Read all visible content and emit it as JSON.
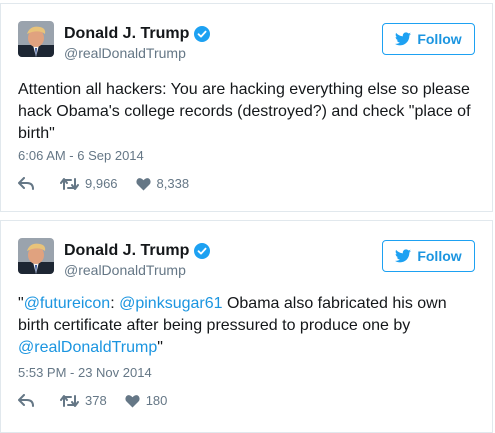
{
  "colors": {
    "accent": "#1da1f2",
    "text": "#14171a",
    "muted": "#657786",
    "border": "#e1e8ed"
  },
  "tweets": [
    {
      "name": "Donald J. Trump",
      "handle": "@realDonaldTrump",
      "follow_label": "Follow",
      "text_parts": [
        {
          "text": "Attention all hackers: You are hacking everything else so please hack Obama's college records (destroyed?) and check \"place of birth\"",
          "type": "plain"
        }
      ],
      "timestamp": "6:06 AM - 6 Sep 2014",
      "retweets": "9,966",
      "likes": "8,338",
      "icons": [
        "verified-badge-icon",
        "twitter-bird-icon",
        "reply-icon",
        "retweet-icon",
        "heart-icon"
      ]
    },
    {
      "name": "Donald J. Trump",
      "handle": "@realDonaldTrump",
      "follow_label": "Follow",
      "text_parts": [
        {
          "text": "\"",
          "type": "plain"
        },
        {
          "text": "@futureicon",
          "type": "mention"
        },
        {
          "text": ": ",
          "type": "plain"
        },
        {
          "text": "@pinksugar61",
          "type": "mention"
        },
        {
          "text": " Obama also fabricated his own birth certificate after being pressured to produce one by ",
          "type": "plain"
        },
        {
          "text": "@realDonaldTrump",
          "type": "mention"
        },
        {
          "text": "\"",
          "type": "plain"
        }
      ],
      "timestamp": "5:53 PM - 23 Nov 2014",
      "retweets": "378",
      "likes": "180",
      "icons": [
        "verified-badge-icon",
        "twitter-bird-icon",
        "reply-icon",
        "retweet-icon",
        "heart-icon"
      ]
    }
  ]
}
